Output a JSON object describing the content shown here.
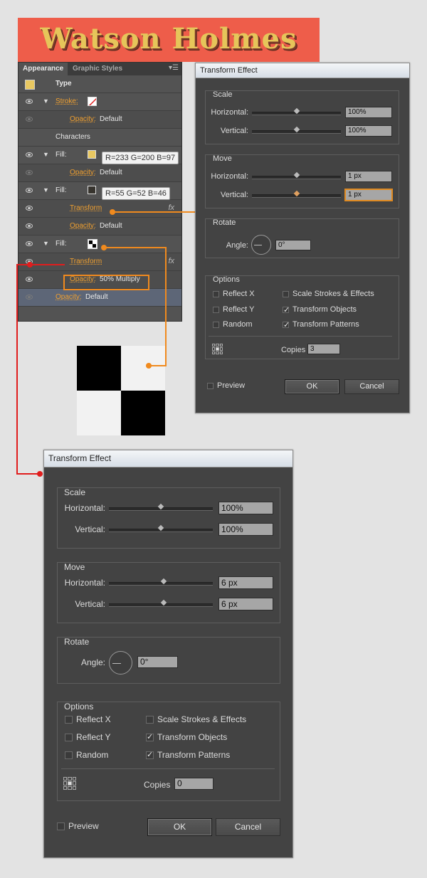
{
  "banner": {
    "title": "Watson Holmes"
  },
  "appearance": {
    "tabs": [
      "Appearance",
      "Graphic Styles"
    ],
    "menu_icon": "panel-menu-icon",
    "rows": [
      {
        "label": "Type"
      },
      {
        "label": "Stroke:"
      },
      {
        "label": "Opacity:",
        "value": "Default"
      },
      {
        "label": "Characters"
      },
      {
        "label": "Fill:",
        "swatch": "#e9c861",
        "callout": "R=233 G=200 B=97"
      },
      {
        "label": "Opacity:",
        "value": "Default"
      },
      {
        "label": "Fill:",
        "swatch": "#37342e",
        "callout": "R=55 G=52 B=46"
      },
      {
        "label": "Transform"
      },
      {
        "label": "Opacity:",
        "value": "Default"
      },
      {
        "label": "Fill:"
      },
      {
        "label": "Transform"
      },
      {
        "label": "Opacity:",
        "value": "50% Multiply"
      },
      {
        "label": "Opacity:",
        "value": "Default"
      }
    ]
  },
  "dialog1": {
    "title": "Transform Effect",
    "scale": {
      "title": "Scale",
      "h_label": "Horizontal:",
      "h_value": "100%",
      "h_pos": 0.5,
      "v_label": "Vertical:",
      "v_value": "100%",
      "v_pos": 0.5
    },
    "move": {
      "title": "Move",
      "h_label": "Horizontal:",
      "h_value": "1 px",
      "h_pos": 0.5,
      "v_label": "Vertical:",
      "v_value": "1 px",
      "v_pos": 0.5
    },
    "rotate": {
      "title": "Rotate",
      "angle_label": "Angle:",
      "angle_value": "0°"
    },
    "options": {
      "title": "Options",
      "reflect_x": {
        "label": "Reflect X",
        "checked": false
      },
      "reflect_y": {
        "label": "Reflect Y",
        "checked": false
      },
      "random": {
        "label": "Random",
        "checked": false
      },
      "scale_strokes": {
        "label": "Scale Strokes & Effects",
        "checked": false
      },
      "transform_objects": {
        "label": "Transform Objects",
        "checked": true
      },
      "transform_patterns": {
        "label": "Transform Patterns",
        "checked": true
      },
      "copies_label": "Copies",
      "copies_value": "3"
    },
    "preview_label": "Preview",
    "ok_label": "OK",
    "cancel_label": "Cancel"
  },
  "dialog2": {
    "title": "Transform Effect",
    "scale": {
      "title": "Scale",
      "h_label": "Horizontal:",
      "h_value": "100%",
      "h_pos": 0.5,
      "v_label": "Vertical:",
      "v_value": "100%",
      "v_pos": 0.5
    },
    "move": {
      "title": "Move",
      "h_label": "Horizontal:",
      "h_value": "6 px",
      "h_pos": 0.53,
      "v_label": "Vertical:",
      "v_value": "6 px",
      "v_pos": 0.53
    },
    "rotate": {
      "title": "Rotate",
      "angle_label": "Angle:",
      "angle_value": "0°"
    },
    "options": {
      "title": "Options",
      "reflect_x": {
        "label": "Reflect X",
        "checked": false
      },
      "reflect_y": {
        "label": "Reflect Y",
        "checked": false
      },
      "random": {
        "label": "Random",
        "checked": false
      },
      "scale_strokes": {
        "label": "Scale Strokes & Effects",
        "checked": false
      },
      "transform_objects": {
        "label": "Transform Objects",
        "checked": true
      },
      "transform_patterns": {
        "label": "Transform Patterns",
        "checked": true
      },
      "copies_label": "Copies",
      "copies_value": "0"
    },
    "preview_label": "Preview",
    "ok_label": "OK",
    "cancel_label": "Cancel"
  },
  "colors": {
    "accent": "#f08a1e",
    "connector_red": "#e01d1d",
    "banner": "#ee5d4a",
    "title_yellow": "#e6c55a"
  }
}
